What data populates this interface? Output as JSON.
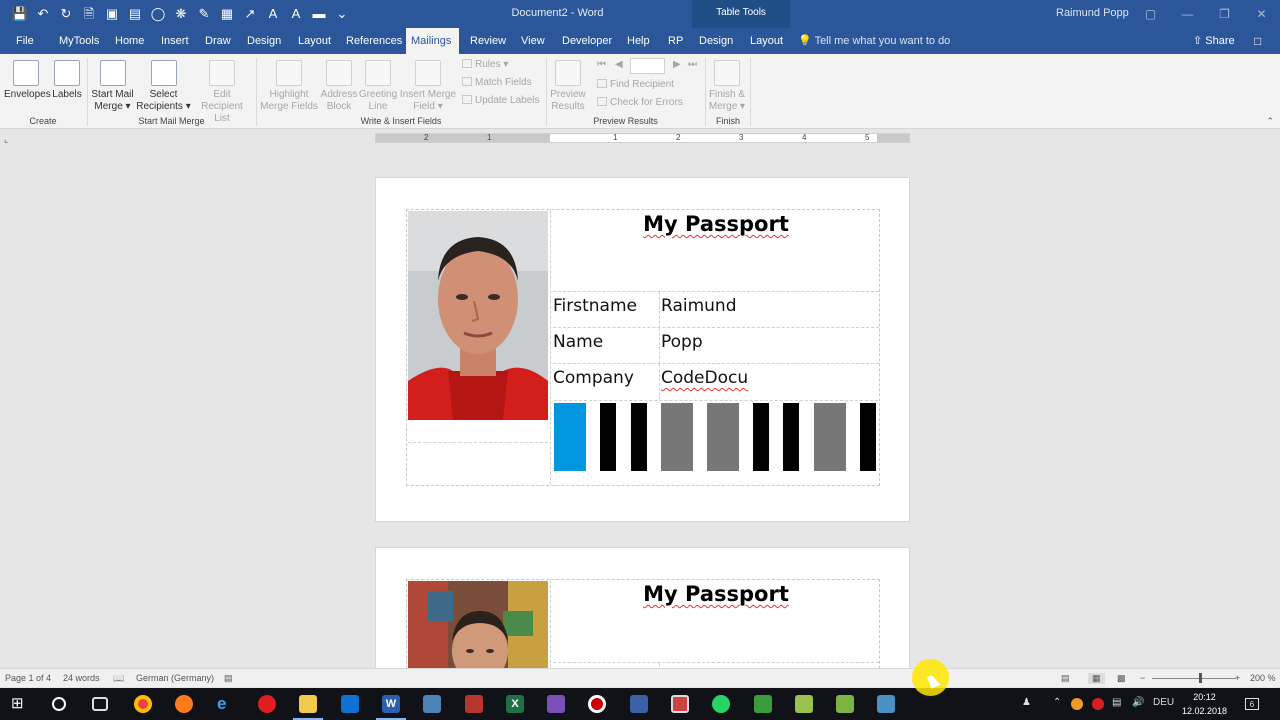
{
  "window": {
    "title": "Document2 - Word",
    "contextual_group": "Table Tools",
    "user": "Raimund Popp"
  },
  "tabs": [
    "File",
    "MyTools",
    "Home",
    "Insert",
    "Draw",
    "Design",
    "Layout",
    "References",
    "Mailings",
    "Review",
    "View",
    "Developer",
    "Help",
    "RP",
    "Design",
    "Layout"
  ],
  "active_tab": "Mailings",
  "tell_me": "Tell me what you want to do",
  "share": "Share",
  "ribbon": {
    "create": {
      "envelopes": "Envelopes",
      "labels": "Labels",
      "group": "Create"
    },
    "start_merge": {
      "start_mail_merge_1": "Start Mail",
      "start_mail_merge_2": "Merge",
      "select_recipients_1": "Select",
      "select_recipients_2": "Recipients",
      "edit_recipient_list_1": "Edit",
      "edit_recipient_list_2": "Recipient List",
      "group": "Start Mail Merge"
    },
    "write_insert": {
      "highlight_1": "Highlight",
      "highlight_2": "Merge Fields",
      "address_1": "Address",
      "address_2": "Block",
      "greeting_1": "Greeting",
      "greeting_2": "Line",
      "insert_field_1": "Insert Merge",
      "insert_field_2": "Field",
      "rules": "Rules",
      "match_fields": "Match Fields",
      "update_labels": "Update Labels",
      "group": "Write & Insert Fields"
    },
    "preview": {
      "preview_1": "Preview",
      "preview_2": "Results",
      "find_recipient": "Find Recipient",
      "check_errors": "Check for Errors",
      "group": "Preview Results"
    },
    "finish": {
      "finish_1": "Finish &",
      "finish_2": "Merge",
      "group": "Finish"
    }
  },
  "ruler": {
    "numbers": [
      "2",
      "1",
      "1",
      "2",
      "3",
      "4",
      "5"
    ]
  },
  "cards": [
    {
      "title": "My Passport",
      "rows": [
        {
          "label": "Firstname",
          "value": "Raimund"
        },
        {
          "label": "Name",
          "value": "Popp"
        },
        {
          "label": "Company",
          "value": "CodeDocu"
        }
      ]
    },
    {
      "title": "My Passport"
    }
  ],
  "barcode_colors": {
    "blue": "#0096e0",
    "black": "#000000",
    "gray": "#777777"
  },
  "status": {
    "page": "Page 1 of 4",
    "words": "24 words",
    "language": "German (Germany)",
    "zoom": "200 %"
  },
  "taskbar": {
    "lang": "DEU",
    "time": "20:12",
    "date": "12.02.2018",
    "notifications": "6"
  }
}
